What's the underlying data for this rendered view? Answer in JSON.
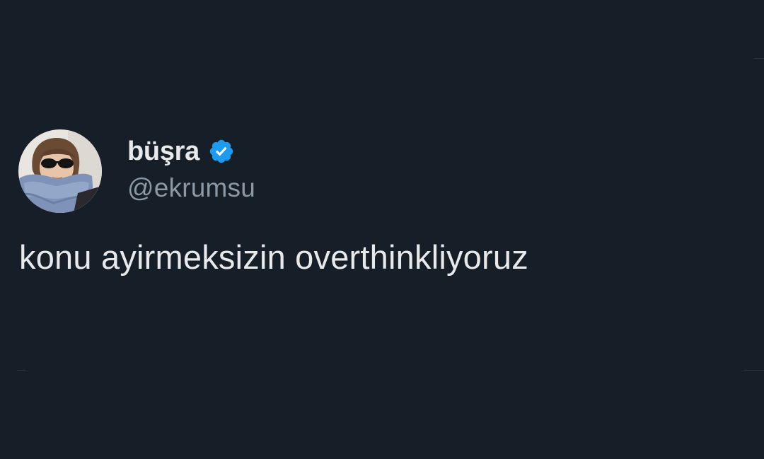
{
  "author": {
    "display_name": "büşra",
    "handle": "@ekrumsu",
    "verified": true,
    "verified_icon": "verified-badge-icon",
    "verified_color": "#1d9bf0"
  },
  "tweet": {
    "text": "konu ayirmeksizin overthinkliyoruz"
  },
  "theme": {
    "background": "#161e28",
    "primary_text": "#e7e9ea",
    "secondary_text": "#8b98a5"
  }
}
